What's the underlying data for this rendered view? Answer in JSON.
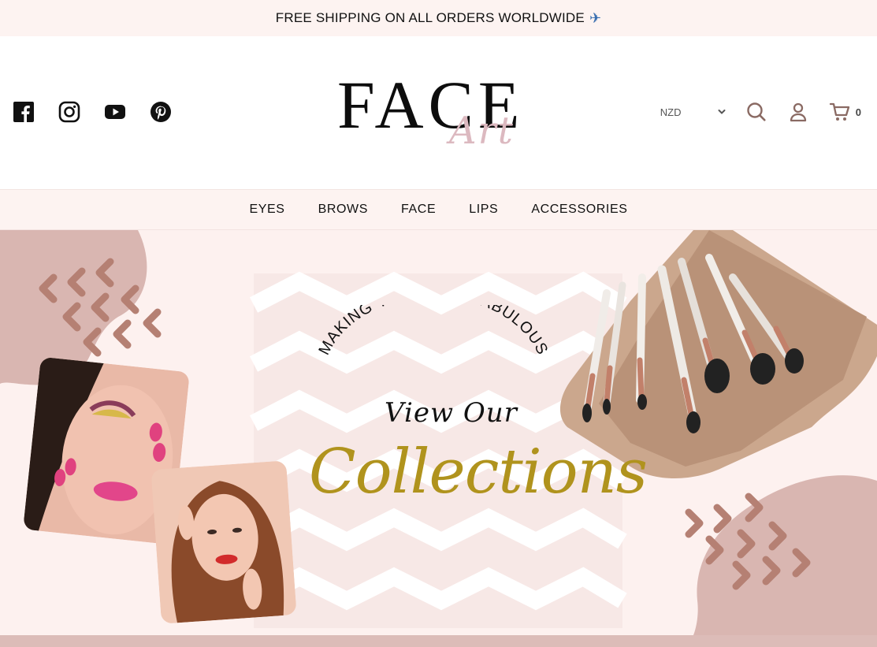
{
  "announcement": {
    "text": "FREE SHIPPING ON ALL ORDERS WORLDWIDE",
    "icon": "airplane-icon"
  },
  "header": {
    "social": [
      "facebook-icon",
      "instagram-icon",
      "youtube-icon",
      "pinterest-icon"
    ],
    "logo": {
      "primary": "FACE",
      "secondary": "Art"
    },
    "currency": {
      "selected": "NZD"
    },
    "cart_count": "0"
  },
  "nav": {
    "items": [
      "EYES",
      "BROWS",
      "FACE",
      "LIPS",
      "ACCESSORIES"
    ]
  },
  "hero": {
    "tagline": "MAKING YOU LOOK FABULOUS",
    "view_our": "View Our",
    "collections": "Collections"
  },
  "colors": {
    "blush": "#fdf1ef",
    "mauve": "#d9b6b1",
    "accent_brown": "#b58073",
    "gold": "#b0931d"
  }
}
